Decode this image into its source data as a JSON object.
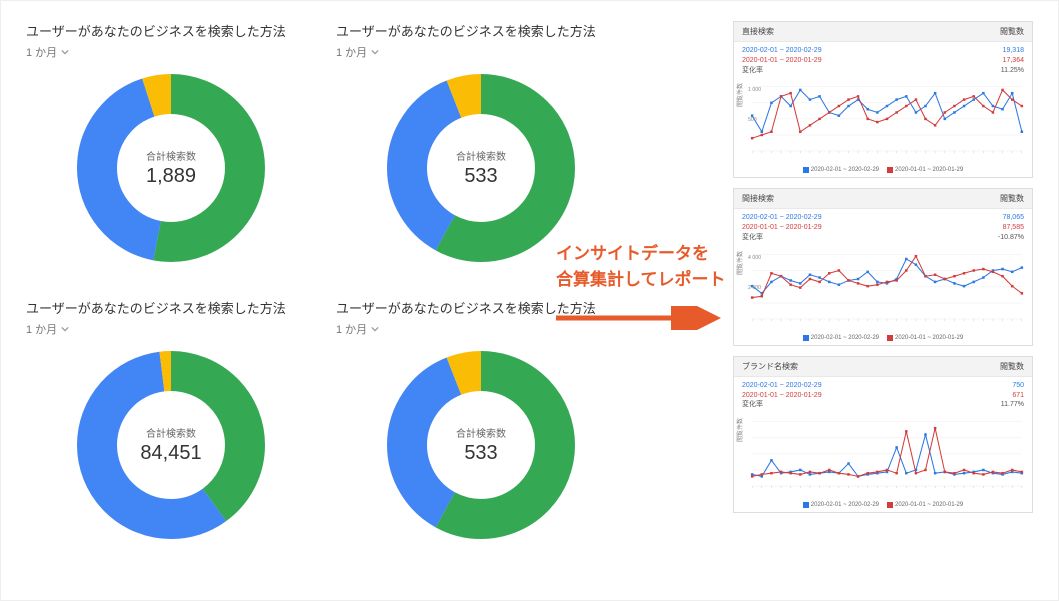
{
  "cards": [
    {
      "title": "ユーザーがあなたのビジネスを検索した方法",
      "period": "1 か月",
      "center_label": "合計検索数",
      "center_value": "1,889"
    },
    {
      "title": "ユーザーがあなたのビジネスを検索した方法",
      "period": "1 か月",
      "center_label": "合計検索数",
      "center_value": "533"
    },
    {
      "title": "ユーザーがあなたのビジネスを検索した方法",
      "period": "1 か月",
      "center_label": "合計検索数",
      "center_value": "84,451"
    },
    {
      "title": "ユーザーがあなたのビジネスを検索した方法",
      "period": "1 か月",
      "center_label": "合計検索数",
      "center_value": "533"
    }
  ],
  "callout": {
    "line1": "インサイトデータを",
    "line2": "合算集計してレポート"
  },
  "panels": [
    {
      "title": "直接検索",
      "metric": "閲覧数",
      "rows": [
        {
          "label": "2020-02-01 ~ 2020-02-29",
          "value": "19,318",
          "cls": "blue"
        },
        {
          "label": "2020-01-01 ~ 2020-01-29",
          "value": "17,364",
          "cls": "red"
        },
        {
          "label": "変化率",
          "value": "11.25%",
          "cls": "gray"
        }
      ],
      "ylabel": "閲覧件数",
      "ymax": "1 000",
      "ymid": "500",
      "legend": [
        "2020-02-01 ~ 2020-02-29",
        "2020-01-01 ~ 2020-01-29"
      ]
    },
    {
      "title": "間接検索",
      "metric": "閲覧数",
      "rows": [
        {
          "label": "2020-02-01 ~ 2020-02-29",
          "value": "78,065",
          "cls": "blue"
        },
        {
          "label": "2020-01-01 ~ 2020-01-29",
          "value": "87,585",
          "cls": "red"
        },
        {
          "label": "変化率",
          "value": "-10.87%",
          "cls": "gray"
        }
      ],
      "ylabel": "閲覧件数",
      "ymax": "4 000",
      "ymid": "2 000",
      "legend": [
        "2020-02-01 ~ 2020-02-29",
        "2020-01-01 ~ 2020-01-29"
      ]
    },
    {
      "title": "ブランド名検索",
      "metric": "閲覧数",
      "rows": [
        {
          "label": "2020-02-01 ~ 2020-02-29",
          "value": "750",
          "cls": "blue"
        },
        {
          "label": "2020-01-01 ~ 2020-01-29",
          "value": "671",
          "cls": "red"
        },
        {
          "label": "変化率",
          "value": "11.77%",
          "cls": "gray"
        }
      ],
      "ylabel": "閲覧件数",
      "ymax": "",
      "ymid": "",
      "legend": [
        "2020-02-01 ~ 2020-02-29",
        "2020-01-01 ~ 2020-01-29"
      ]
    }
  ],
  "chart_data": [
    {
      "type": "pie",
      "title": "合計検索数 1,889",
      "series": [
        {
          "name": "green",
          "value": 53,
          "color": "#34a853"
        },
        {
          "name": "blue",
          "value": 42,
          "color": "#4285f4"
        },
        {
          "name": "yellow",
          "value": 5,
          "color": "#fbbc05"
        }
      ]
    },
    {
      "type": "pie",
      "title": "合計検索数 533",
      "series": [
        {
          "name": "green",
          "value": 58,
          "color": "#34a853"
        },
        {
          "name": "blue",
          "value": 36,
          "color": "#4285f4"
        },
        {
          "name": "yellow",
          "value": 6,
          "color": "#fbbc05"
        }
      ]
    },
    {
      "type": "pie",
      "title": "合計検索数 84,451",
      "series": [
        {
          "name": "green",
          "value": 40,
          "color": "#34a853"
        },
        {
          "name": "blue",
          "value": 58,
          "color": "#4285f4"
        },
        {
          "name": "yellow",
          "value": 2,
          "color": "#fbbc05"
        }
      ]
    },
    {
      "type": "pie",
      "title": "合計検索数 533",
      "series": [
        {
          "name": "green",
          "value": 58,
          "color": "#34a853"
        },
        {
          "name": "blue",
          "value": 36,
          "color": "#4285f4"
        },
        {
          "name": "yellow",
          "value": 6,
          "color": "#fbbc05"
        }
      ]
    },
    {
      "type": "line",
      "title": "直接検索",
      "ylabel": "閲覧件数",
      "ylim": [
        0,
        1000
      ],
      "x": [
        1,
        2,
        3,
        4,
        5,
        6,
        7,
        8,
        9,
        10,
        11,
        12,
        13,
        14,
        15,
        16,
        17,
        18,
        19,
        20,
        21,
        22,
        23,
        24,
        25,
        26,
        27,
        28,
        29
      ],
      "series": [
        {
          "name": "2020-02-01 ~ 2020-02-29",
          "color": "#2b78e4",
          "values": [
            550,
            300,
            750,
            850,
            700,
            950,
            800,
            850,
            600,
            550,
            700,
            800,
            650,
            600,
            700,
            800,
            850,
            600,
            700,
            900,
            500,
            600,
            700,
            800,
            900,
            700,
            650,
            900,
            300
          ]
        },
        {
          "name": "2020-01-01 ~ 2020-01-29",
          "color": "#d23c3c",
          "values": [
            200,
            250,
            300,
            850,
            900,
            300,
            400,
            500,
            600,
            700,
            800,
            850,
            500,
            450,
            500,
            600,
            700,
            800,
            500,
            400,
            600,
            700,
            800,
            850,
            700,
            600,
            950,
            800,
            700
          ]
        }
      ]
    },
    {
      "type": "line",
      "title": "間接検索",
      "ylabel": "閲覧件数",
      "ylim": [
        0,
        4500
      ],
      "x": [
        1,
        2,
        3,
        4,
        5,
        6,
        7,
        8,
        9,
        10,
        11,
        12,
        13,
        14,
        15,
        16,
        17,
        18,
        19,
        20,
        21,
        22,
        23,
        24,
        25,
        26,
        27,
        28,
        29
      ],
      "series": [
        {
          "name": "2020-02-01 ~ 2020-02-29",
          "color": "#2b78e4",
          "values": [
            2300,
            1800,
            2600,
            3000,
            2700,
            2500,
            3100,
            2900,
            2600,
            2400,
            2700,
            2800,
            3300,
            2600,
            2500,
            2800,
            4200,
            3800,
            3000,
            2600,
            2800,
            2500,
            2300,
            2600,
            2900,
            3400,
            3500,
            3300,
            3600
          ]
        },
        {
          "name": "2020-01-01 ~ 2020-01-29",
          "color": "#d23c3c",
          "values": [
            1500,
            1600,
            3200,
            3000,
            2400,
            2200,
            2800,
            2600,
            3200,
            3400,
            2700,
            2500,
            2300,
            2400,
            2600,
            2700,
            3400,
            4400,
            3000,
            3100,
            2800,
            3000,
            3200,
            3400,
            3500,
            3300,
            3000,
            2300,
            1800
          ]
        }
      ]
    },
    {
      "type": "line",
      "title": "ブランド名検索",
      "ylabel": "閲覧件数",
      "ylim": [
        0,
        100
      ],
      "x": [
        1,
        2,
        3,
        4,
        5,
        6,
        7,
        8,
        9,
        10,
        11,
        12,
        13,
        14,
        15,
        16,
        17,
        18,
        19,
        20,
        21,
        22,
        23,
        24,
        25,
        26,
        27,
        28,
        29
      ],
      "series": [
        {
          "name": "2020-02-01 ~ 2020-02-29",
          "color": "#2b78e4",
          "values": [
            18,
            15,
            40,
            20,
            22,
            25,
            18,
            20,
            22,
            20,
            35,
            15,
            18,
            20,
            22,
            60,
            20,
            25,
            80,
            20,
            22,
            18,
            20,
            22,
            25,
            20,
            18,
            22,
            20
          ]
        },
        {
          "name": "2020-01-01 ~ 2020-01-29",
          "color": "#d23c3c",
          "values": [
            15,
            18,
            20,
            22,
            20,
            18,
            22,
            20,
            25,
            20,
            18,
            15,
            20,
            22,
            25,
            20,
            85,
            20,
            25,
            90,
            22,
            20,
            25,
            20,
            18,
            22,
            20,
            25,
            22
          ]
        }
      ]
    }
  ]
}
